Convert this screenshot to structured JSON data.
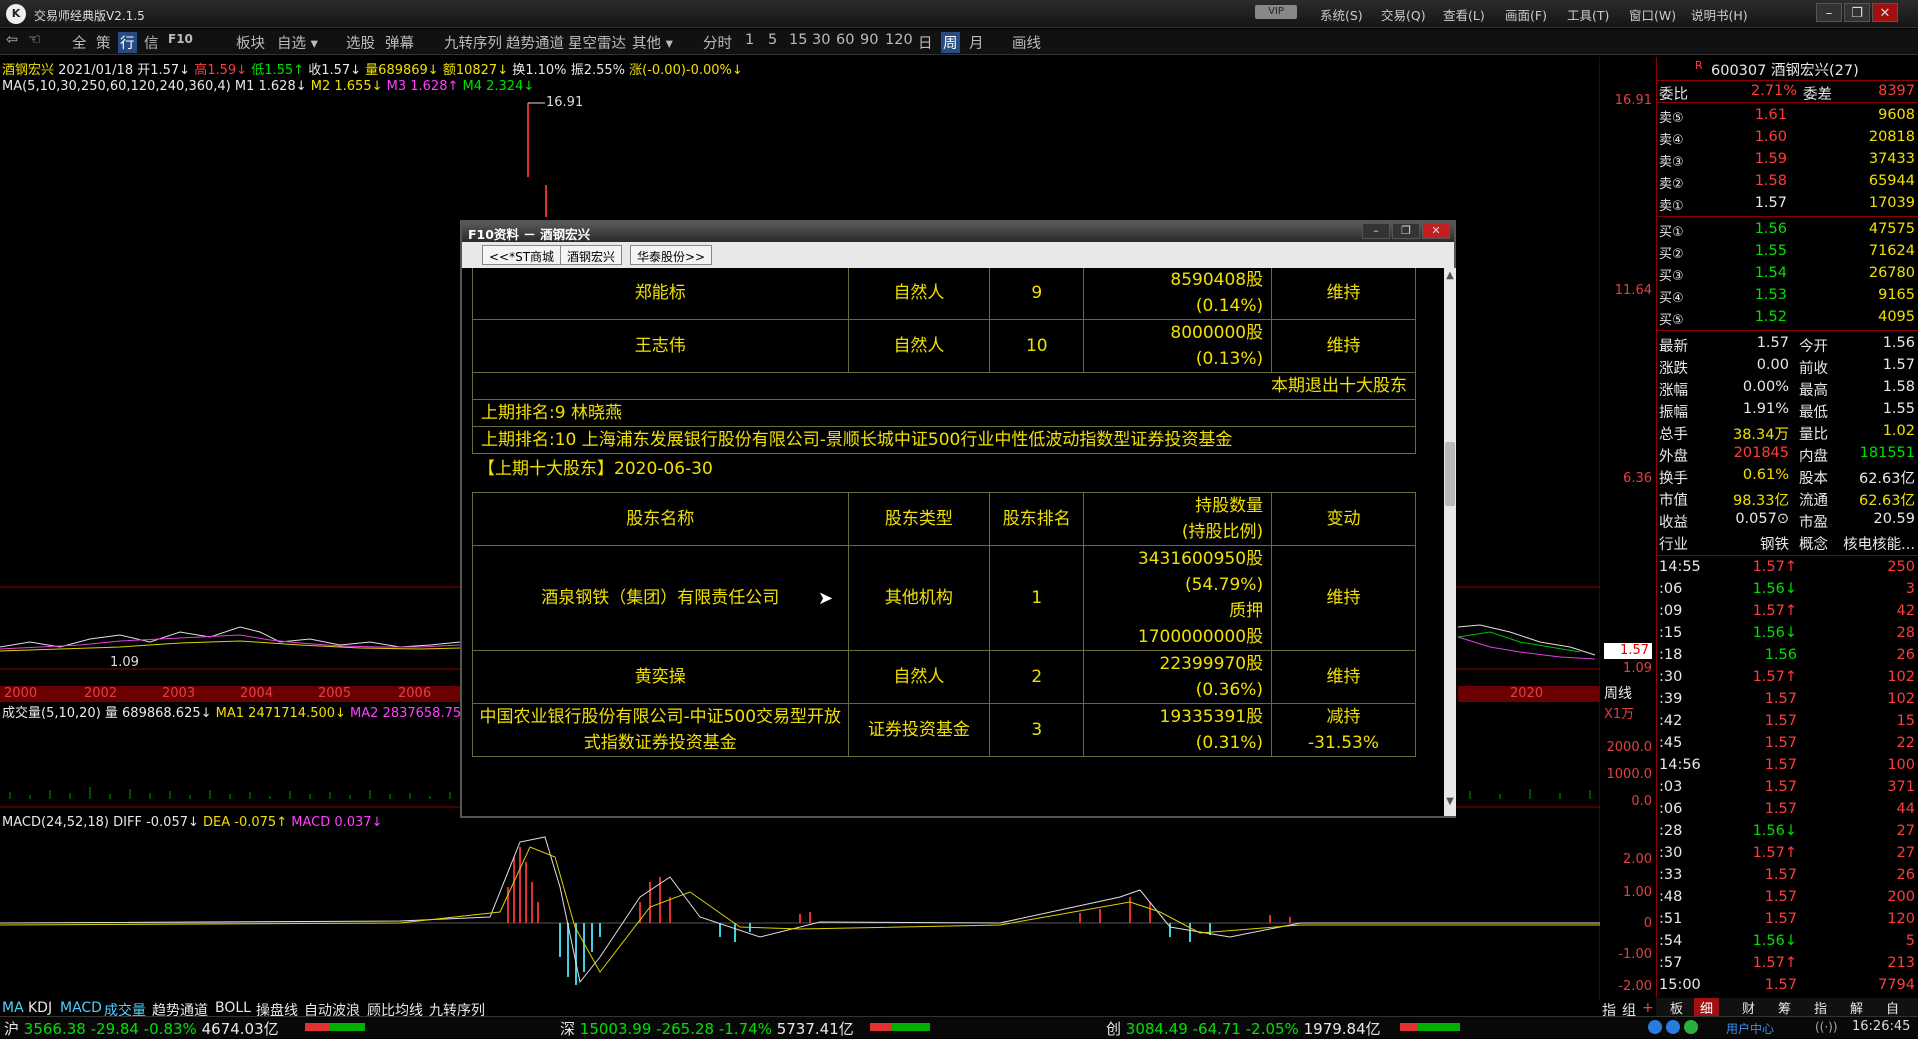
{
  "app": {
    "title": "交易师经典版V2.1.5",
    "vip": "VIP",
    "menus": [
      "系统(S)",
      "交易(Q)",
      "查看(L)",
      "画面(F)",
      "工具(T)",
      "窗口(W)",
      "说明书(H)"
    ],
    "toolbar": [
      "全",
      "策",
      "行",
      "信",
      "F10",
      "板块",
      "自选 ▾",
      "选股",
      "弹幕",
      "九转序列",
      "趋势通道",
      "星空雷达",
      "其他 ▾",
      "分时",
      "1",
      "5",
      "15",
      "30",
      "60",
      "90",
      "120",
      "日",
      "周",
      "月",
      "画线"
    ],
    "toolbar_selected": "周"
  },
  "chart": {
    "info_line": {
      "name": "酒钢宏兴",
      "date": "2021/01/18",
      "open": "开1.57↓",
      "high": "高1.59↓",
      "low": "低1.55↑",
      "close": "收1.57↓",
      "vol": "量689869↓",
      "amt": "额10827↓",
      "turn": "换1.10%",
      "amp": "振2.55%",
      "chg": "涨(-0.00)-0.00%↓"
    },
    "ma_line": {
      "label": "MA(5,10,30,250,60,120,240,360,4)",
      "m1": "M1 1.628↓",
      "m2": "M2 1.655↓",
      "m3": "M3 1.628↑",
      "m4": "M4 2.324↓"
    },
    "peak_label": "16.91",
    "low_label": "1.09",
    "price_axis": [
      "16.91",
      "11.64",
      "6.36",
      "1.09"
    ],
    "last_price_tag": "1.57",
    "years": [
      "2000",
      "2002",
      "2003",
      "2004",
      "2005",
      "2006",
      "2020"
    ],
    "period_label": "周线",
    "vol_line": {
      "label": "成交量(5,10,20)",
      "vol": "量 689868.625↓",
      "ma1": "MA1 2471714.500↓",
      "ma2": "MA2 2837658.75"
    },
    "vol_unit": "X1万",
    "vol_axis": [
      "2000.0",
      "1000.0",
      "0.0"
    ],
    "macd_line": {
      "label": "MACD(24,52,18)",
      "diff": "DIFF -0.057↓",
      "dea": "DEA -0.075↑",
      "macd": "MACD 0.037↓"
    },
    "macd_axis": [
      "2.00",
      "1.00",
      "0",
      "-1.00",
      "-2.00"
    ],
    "bottom_tabs": [
      "MA",
      "KDJ",
      "MACD",
      "成交量",
      "趋势通道",
      "BOLL",
      "操盘线",
      "自动波浪",
      "顾比均线",
      "九转序列"
    ],
    "bottom_right": [
      "指",
      "组",
      "+"
    ]
  },
  "dialog": {
    "title": "F10资料 － 酒钢宏兴",
    "nav": [
      "<<*ST商城",
      "酒钢宏兴",
      "华泰股份>>"
    ],
    "top_rows": [
      {
        "name": "郑能标",
        "type": "自然人",
        "rank": "9",
        "qty": "8590408股",
        "pct": "(0.14%)",
        "chg": "维持"
      },
      {
        "name": "王志伟",
        "type": "自然人",
        "rank": "10",
        "qty": "8000000股",
        "pct": "(0.13%)",
        "chg": "维持"
      }
    ],
    "exit_label": "本期退出十大股东",
    "exit_rows": [
      "上期排名:9 林晓燕",
      "上期排名:10 上海浦东发展银行股份有限公司-景顺长城中证500行业中性低波动指数型证券投资基金"
    ],
    "section_title": "【上期十大股东】2020-06-30",
    "headers": [
      "股东名称",
      "股东类型",
      "股东排名",
      "持股数量",
      "(持股比例)",
      "变动"
    ],
    "rows": [
      {
        "name": "酒泉钢铁（集团）有限责任公司",
        "type": "其他机构",
        "rank": "1",
        "qty": "3431600950股",
        "pct": "(54.79%)",
        "extra1": "质押",
        "extra2": "1700000000股",
        "chg": "维持"
      },
      {
        "name": "黄奕操",
        "type": "自然人",
        "rank": "2",
        "qty": "22399970股",
        "pct": "(0.36%)",
        "chg": "维持"
      },
      {
        "name": "中国农业银行股份有限公司-中证500交易型开放式指数证券投资基金",
        "type": "证券投资基金",
        "rank": "3",
        "qty": "19335391股",
        "pct": "(0.31%)",
        "chg": "减持",
        "chg2": "-31.53%"
      }
    ]
  },
  "quote": {
    "header": {
      "flag": "R",
      "code": "600307 酒钢宏兴(27)"
    },
    "weibi": {
      "label": "委比",
      "val": "2.71%",
      "label2": "委差",
      "val2": "8397"
    },
    "asks": [
      {
        "l": "卖⑤",
        "p": "1.61",
        "v": "9608"
      },
      {
        "l": "卖④",
        "p": "1.60",
        "v": "20818"
      },
      {
        "l": "卖③",
        "p": "1.59",
        "v": "37433"
      },
      {
        "l": "卖②",
        "p": "1.58",
        "v": "65944"
      },
      {
        "l": "卖①",
        "p": "1.57",
        "v": "17039"
      }
    ],
    "bids": [
      {
        "l": "买①",
        "p": "1.56",
        "v": "47575"
      },
      {
        "l": "买②",
        "p": "1.55",
        "v": "71624"
      },
      {
        "l": "买③",
        "p": "1.54",
        "v": "26780"
      },
      {
        "l": "买④",
        "p": "1.53",
        "v": "9165"
      },
      {
        "l": "买⑤",
        "p": "1.52",
        "v": "4095"
      }
    ],
    "stats": [
      {
        "a": "最新",
        "b": "1.57",
        "c": "今开",
        "d": "1.56"
      },
      {
        "a": "涨跌",
        "b": "0.00",
        "c": "前收",
        "d": "1.57"
      },
      {
        "a": "涨幅",
        "b": "0.00%",
        "c": "最高",
        "d": "1.58"
      },
      {
        "a": "振幅",
        "b": "1.91%",
        "c": "最低",
        "d": "1.55"
      },
      {
        "a": "总手",
        "b": "38.34万",
        "c": "量比",
        "d": "1.02"
      },
      {
        "a": "外盘",
        "b": "201845",
        "c": "内盘",
        "d": "181551"
      },
      {
        "a": "换手",
        "b": "0.61%",
        "c": "股本",
        "d": "62.63亿"
      },
      {
        "a": "市值",
        "b": "98.33亿",
        "c": "流通",
        "d": "62.63亿"
      },
      {
        "a": "收益",
        "b": "0.057⊙",
        "c": "市盈",
        "d": "20.59"
      },
      {
        "a": "行业",
        "b": "钢铁",
        "c": "概念",
        "d": "核电核能..."
      }
    ],
    "ticks": [
      {
        "t": "14:55",
        "p": "1.57↑",
        "v": "250"
      },
      {
        "t": ":06",
        "p": "1.56↓",
        "v": "3"
      },
      {
        "t": ":09",
        "p": "1.57↑",
        "v": "42"
      },
      {
        "t": ":15",
        "p": "1.56↓",
        "v": "28"
      },
      {
        "t": ":18",
        "p": "1.56",
        "v": "26"
      },
      {
        "t": ":30",
        "p": "1.57↑",
        "v": "102"
      },
      {
        "t": ":39",
        "p": "1.57",
        "v": "102"
      },
      {
        "t": ":42",
        "p": "1.57",
        "v": "15"
      },
      {
        "t": ":45",
        "p": "1.57",
        "v": "22"
      },
      {
        "t": "14:56",
        "p": "1.57",
        "v": "100"
      },
      {
        "t": ":03",
        "p": "1.57",
        "v": "371"
      },
      {
        "t": ":06",
        "p": "1.57",
        "v": "44"
      },
      {
        "t": ":28",
        "p": "1.56↓",
        "v": "27"
      },
      {
        "t": ":30",
        "p": "1.57↑",
        "v": "27"
      },
      {
        "t": ":33",
        "p": "1.57",
        "v": "26"
      },
      {
        "t": ":48",
        "p": "1.57",
        "v": "200"
      },
      {
        "t": ":51",
        "p": "1.57",
        "v": "120"
      },
      {
        "t": ":54",
        "p": "1.56↓",
        "v": "5"
      },
      {
        "t": ":57",
        "p": "1.57↑",
        "v": "213"
      },
      {
        "t": "15:00",
        "p": "1.57",
        "v": "7794"
      }
    ],
    "tabs": [
      "板",
      "细",
      "财",
      "筹",
      "指",
      "解",
      "自"
    ]
  },
  "status": {
    "sh": {
      "n": "沪",
      "v": "3566.38",
      "c": "-29.84",
      "p": "-0.83%",
      "a": "4674.03亿"
    },
    "sz": {
      "n": "深",
      "v": "15003.99",
      "c": "-265.28",
      "p": "-1.74%",
      "a": "5737.41亿"
    },
    "cy": {
      "n": "创",
      "v": "3084.49",
      "c": "-64.71",
      "p": "-2.05%",
      "a": "1979.84亿"
    },
    "user": "用户中心",
    "time": "16:26:45"
  }
}
